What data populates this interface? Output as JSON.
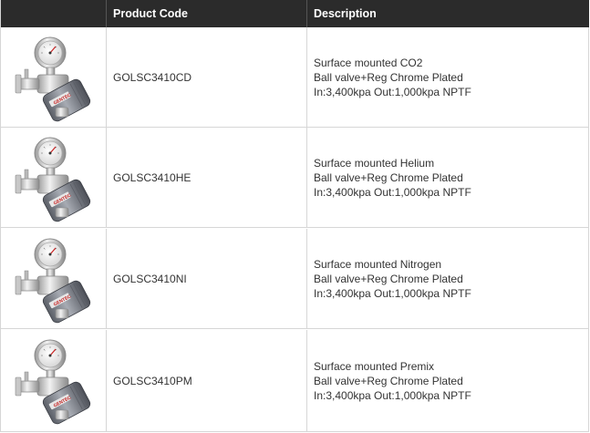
{
  "table": {
    "headers": {
      "image": "",
      "code": "Product Code",
      "description": "Description"
    },
    "rows": [
      {
        "code": "GOLSC3410CD",
        "lines": [
          "Surface mounted CO2",
          "Ball valve+Reg Chrome Plated",
          "In:3,400kpa Out:1,000kpa NPTF"
        ]
      },
      {
        "code": "GOLSC3410HE",
        "lines": [
          "Surface mounted Helium",
          "Ball valve+Reg Chrome Plated",
          "In:3,400kpa Out:1,000kpa NPTF"
        ]
      },
      {
        "code": "GOLSC3410NI",
        "lines": [
          "Surface mounted Nitrogen",
          "Ball valve+Reg Chrome Plated",
          "In:3,400kpa Out:1,000kpa NPTF"
        ]
      },
      {
        "code": "GOLSC3410PM",
        "lines": [
          "Surface mounted Premix",
          "Ball valve+Reg Chrome Plated",
          "In:3,400kpa Out:1,000kpa NPTF"
        ]
      }
    ],
    "product_icon": "gas-regulator-icon",
    "colors": {
      "header_bg": "#2b2b2b",
      "header_text": "#ffffff",
      "border": "#d6d6d6",
      "text": "#333333"
    }
  }
}
